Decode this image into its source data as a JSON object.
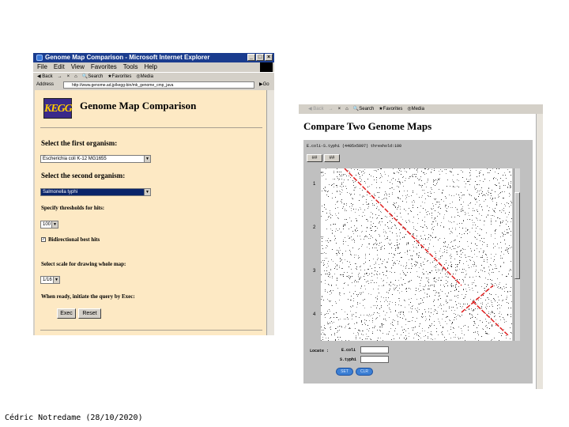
{
  "left_window": {
    "title": "Genome Map Comparison - Microsoft Internet Explorer",
    "menu": [
      "File",
      "Edit",
      "View",
      "Favorites",
      "Tools",
      "Help"
    ],
    "toolbar": [
      "Back",
      "→",
      "×",
      "⌂",
      "Search",
      "Favorites",
      "Media"
    ],
    "address_label": "Address",
    "address_url": "http://www.genome.ad.jp/kegg-bin/mk_genome_cmp_java",
    "go_label": "Go",
    "logo_text": "KEGG",
    "page_title": "Genome Map Comparison",
    "first_organism_label": "Select the first organism:",
    "first_organism_value": "Escherichia coli K-12 MG1655",
    "second_organism_label": "Select the second organism:",
    "second_organism_value": "Salmonella typhi",
    "thresholds_label": "Specify thresholds for hits:",
    "threshold_value": "100",
    "bidirectional_label": "Bidirectional best hits",
    "bidirectional_checked": true,
    "scale_label": "Select scale for drawing whole map:",
    "scale_value": "1/16",
    "ready_label": "When ready, initiate the query by Exec:",
    "exec_label": "Exec",
    "reset_label": "Reset"
  },
  "right_window": {
    "toolbar": [
      "Back",
      "→",
      "×",
      "⌂",
      "Search",
      "Favorites",
      "Media"
    ],
    "page_title": "Compare Two Genome Maps",
    "applet_info": "E.coli-S.typhi (4405x5097)   threshold:100",
    "nav_buttons": [
      "##",
      "##"
    ],
    "y_axis_labels": [
      "1",
      "2",
      "3",
      "4"
    ],
    "locate_label": "Locate :",
    "locate_fields": [
      {
        "label": "E.coli",
        "value": ""
      },
      {
        "label": "S.typhi",
        "value": ""
      }
    ],
    "pill_buttons": [
      "SET",
      "CLR"
    ],
    "diagonal_color": "#e02020"
  },
  "credit": "Cédric Notredame (28/10/2020)"
}
